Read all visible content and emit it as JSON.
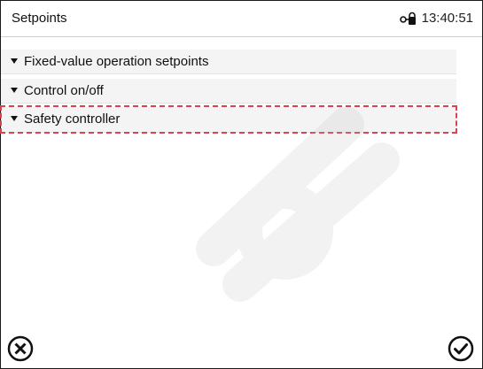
{
  "header": {
    "title": "Setpoints",
    "time": "13:40:51",
    "lock_icon": "lock-icon"
  },
  "menu": {
    "items": [
      {
        "label": "Fixed-value operation setpoints",
        "icon": "chevron-down-icon"
      },
      {
        "label": "Control on/off",
        "icon": "chevron-down-icon"
      },
      {
        "label": "Safety controller",
        "icon": "chevron-down-icon",
        "highlighted": true
      }
    ]
  },
  "footer": {
    "cancel_icon": "close-circle-icon",
    "confirm_icon": "check-circle-icon"
  },
  "colors": {
    "highlight_outline": "#d9434f",
    "item_background": "#f4f4f4",
    "border": "#1a1a1a"
  }
}
